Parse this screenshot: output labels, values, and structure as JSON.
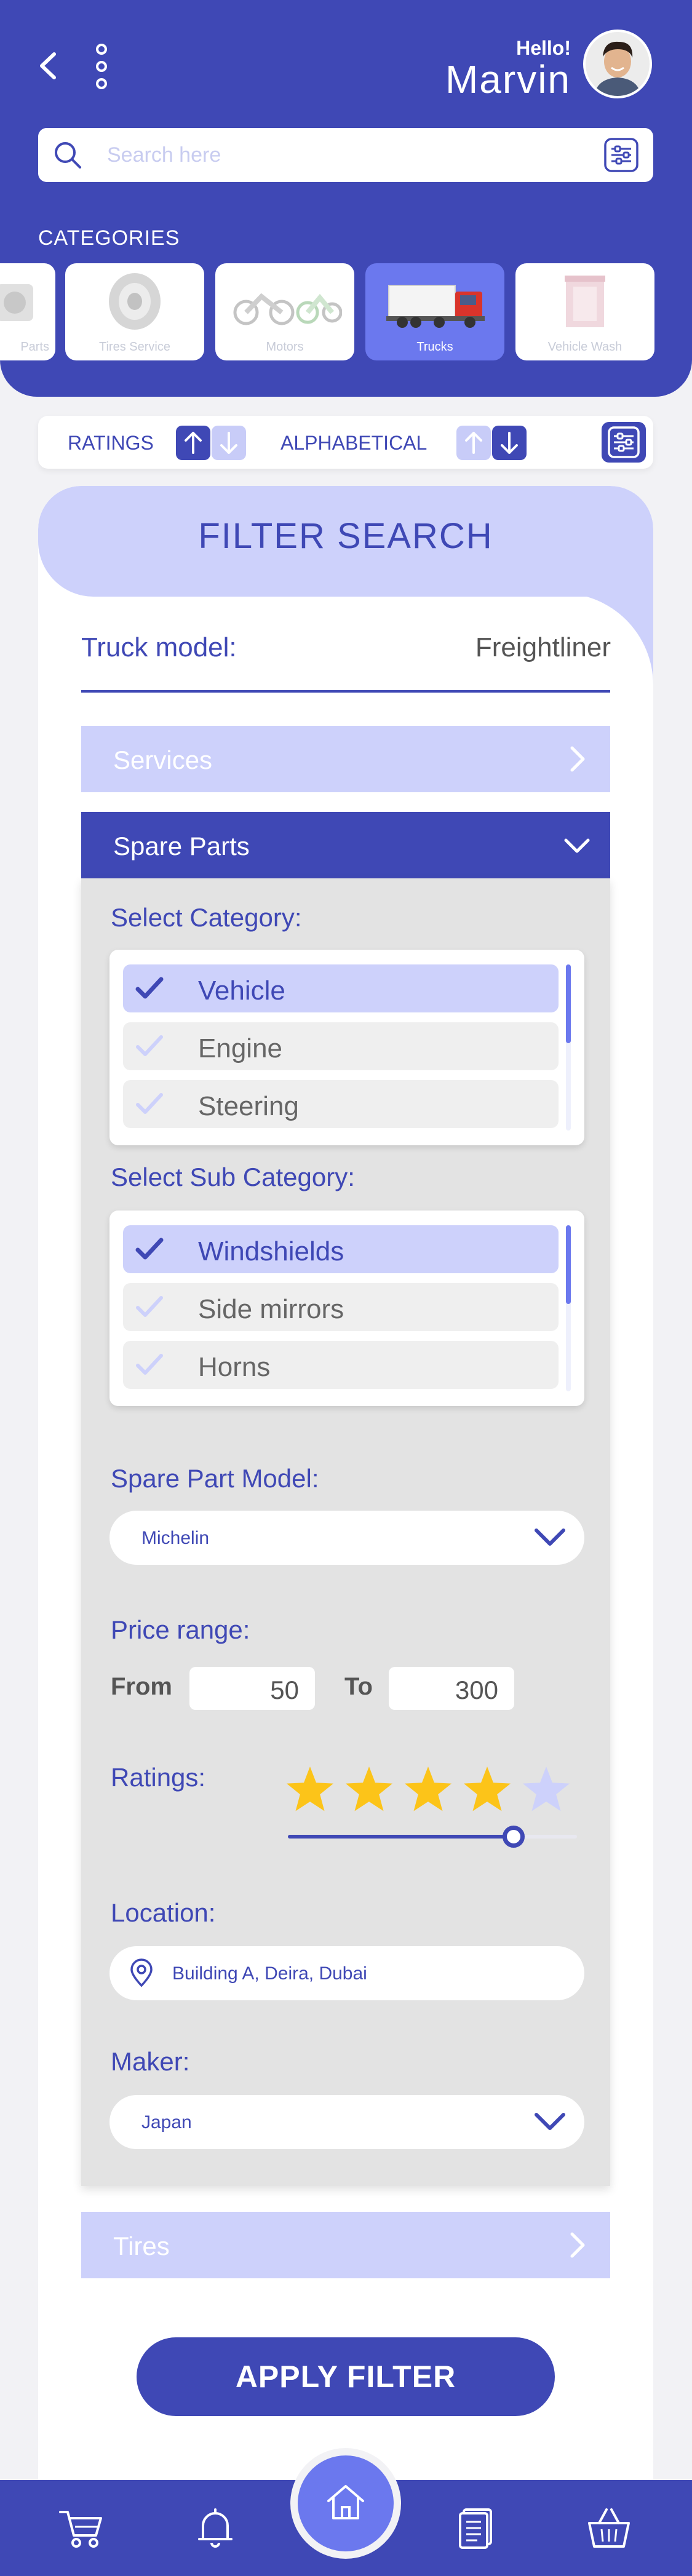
{
  "header": {
    "greeting": "Hello!",
    "user_name": "Marvin",
    "search_placeholder": "Search here",
    "categories_title": "CATEGORIES",
    "categories": [
      {
        "label": "Parts"
      },
      {
        "label": "Tires Service"
      },
      {
        "label": "Motors"
      },
      {
        "label": "Trucks",
        "active": true
      },
      {
        "label": "Vehicle Wash"
      }
    ]
  },
  "sort": {
    "ratings_label": "RATINGS",
    "alphabetical_label": "ALPHABETICAL"
  },
  "filter": {
    "title": "FILTER SEARCH",
    "truck_model_label": "Truck model:",
    "truck_model_value": "Freightliner",
    "sections": {
      "services": "Services",
      "spare_parts": "Spare Parts",
      "tires": "Tires"
    },
    "select_category_label": "Select Category:",
    "categories": [
      {
        "label": "Vehicle",
        "selected": true
      },
      {
        "label": "Engine",
        "selected": false
      },
      {
        "label": "Steering",
        "selected": false
      }
    ],
    "select_sub_category_label": "Select Sub Category:",
    "sub_categories": [
      {
        "label": "Windshields",
        "selected": true
      },
      {
        "label": "Side mirrors",
        "selected": false
      },
      {
        "label": "Horns",
        "selected": false
      }
    ],
    "spare_part_model_label": "Spare Part Model:",
    "spare_part_model_value": "Michelin",
    "price_range_label": "Price range:",
    "price_from_label": "From",
    "price_from_value": "50",
    "price_to_label": "To",
    "price_to_value": "300",
    "ratings_label": "Ratings:",
    "rating_value": 4,
    "rating_max": 5,
    "rating_slider_fraction": 0.78,
    "location_label": "Location:",
    "location_value": "Building A, Deira, Dubai",
    "maker_label": "Maker:",
    "maker_value": "Japan",
    "apply_label": "APPLY FILTER"
  },
  "colors": {
    "primary": "#3f48b5",
    "light": "#cdd1fb",
    "star": "#fcc419",
    "star_empty": "#cdd1fb"
  },
  "nav": {
    "icons": [
      "cart-icon",
      "bell-icon",
      "home-icon",
      "documents-icon",
      "basket-icon"
    ]
  }
}
